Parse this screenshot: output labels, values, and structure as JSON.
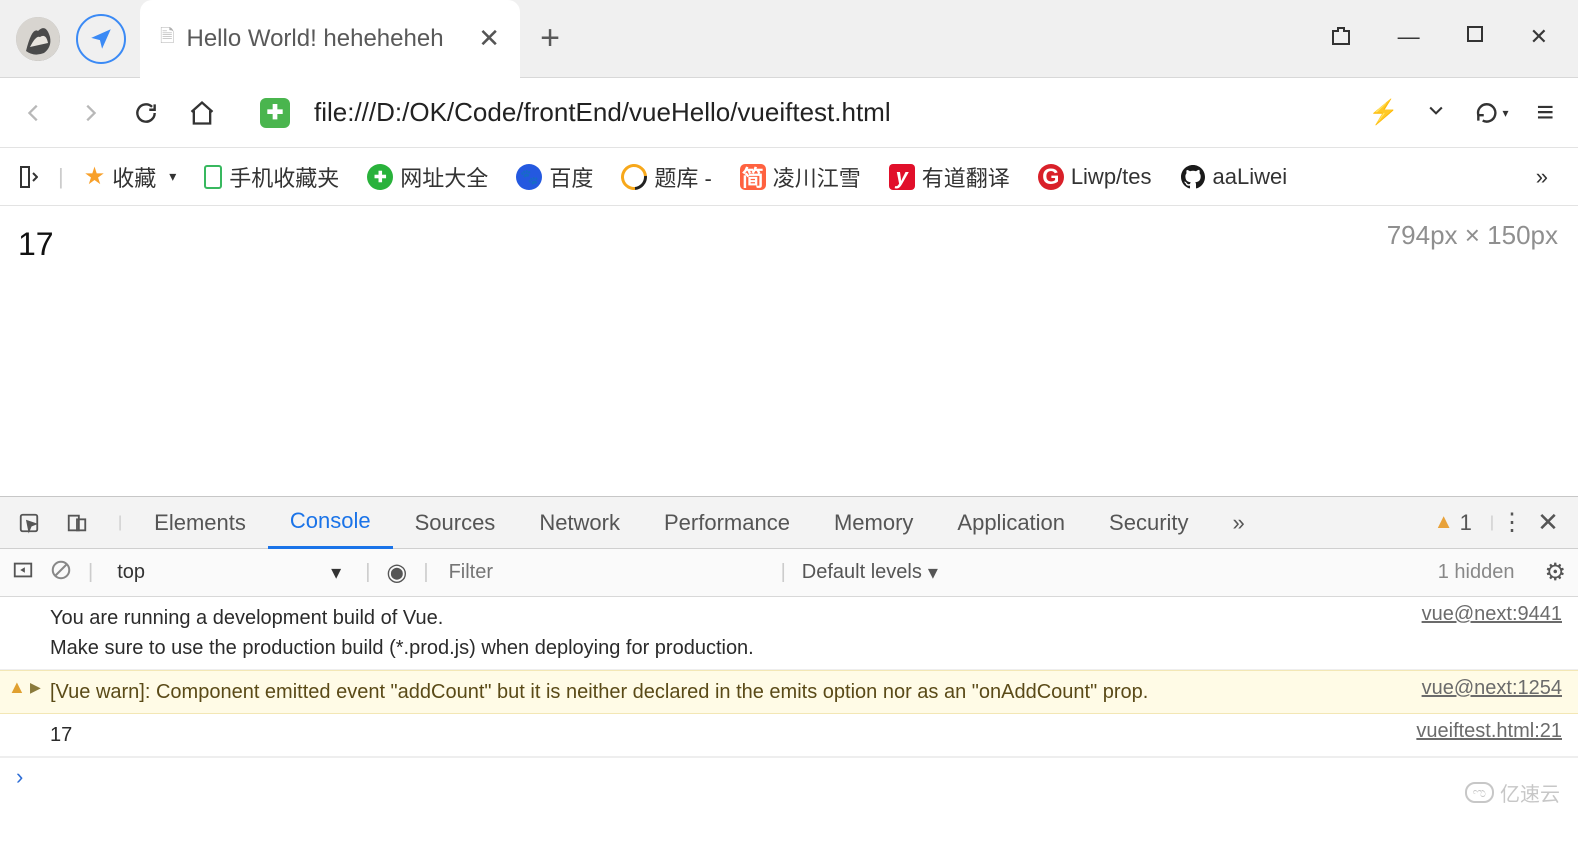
{
  "tabbar": {
    "tab_title": "Hello World! heheheheh",
    "new_tab": "+"
  },
  "win": {
    "shirt": "👕",
    "min": "—",
    "max": "☐",
    "close": "✕"
  },
  "nav": {
    "url": "file:///D:/OK/Code/frontEnd/vueHello/vueiftest.html",
    "back": "‹",
    "fwd": "›",
    "reload": "⟳",
    "home": "⌂",
    "dropdown": "⌄",
    "undo": "↶",
    "menu": "≡"
  },
  "bookmarks": {
    "toggle": "▷",
    "fav": "收藏",
    "mobile_fav": "手机收藏夹",
    "site_daquan": "网址大全",
    "baidu": "百度",
    "tiku": "题库 -",
    "lingchuan": "凌川江雪",
    "youdao": "有道翻译",
    "liwp": "Liwp/tes",
    "aaliwei": "aaLiwei",
    "more": "»"
  },
  "page": {
    "content_value": "17",
    "dimensions": "794px × 150px"
  },
  "devtools": {
    "tabs": {
      "elements": "Elements",
      "console": "Console",
      "sources": "Sources",
      "network": "Network",
      "performance": "Performance",
      "memory": "Memory",
      "application": "Application",
      "security": "Security",
      "more": "»"
    },
    "warn_count": "1",
    "toolbar": {
      "context": "top",
      "filter_placeholder": "Filter",
      "levels": "Default levels",
      "hidden": "1 hidden"
    },
    "logs": {
      "info_msg": "You are running a development build of Vue.\nMake sure to use the production build (*.prod.js) when deploying for production.",
      "info_src": "vue@next:9441",
      "warn_msg": "[Vue warn]: Component emitted event \"addCount\" but it is neither declared in the emits option nor as an \"onAddCount\" prop.",
      "warn_src": "vue@next:1254",
      "plain_msg": "17",
      "plain_src": "vueiftest.html:21",
      "prompt": "›"
    }
  },
  "watermark": "亿速云"
}
